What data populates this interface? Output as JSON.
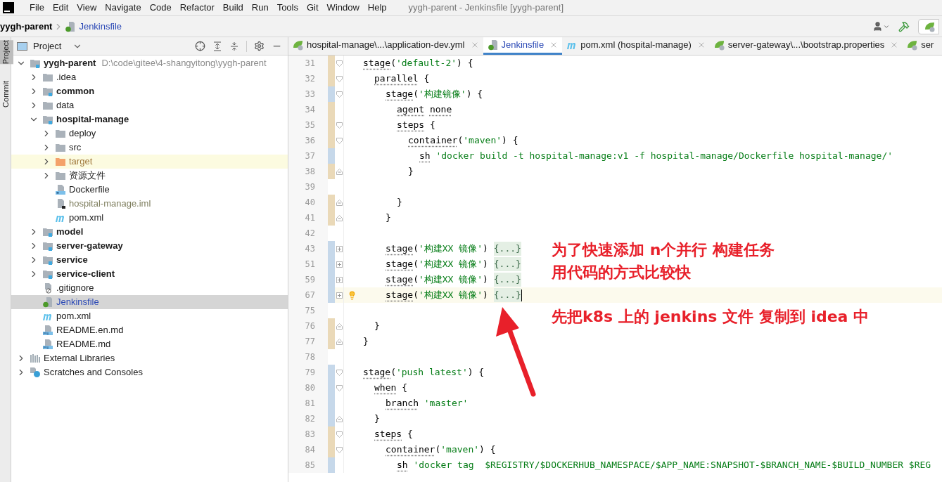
{
  "window": {
    "title": "yygh-parent - Jenkinsfile [yygh-parent]"
  },
  "menu": [
    "File",
    "Edit",
    "View",
    "Navigate",
    "Code",
    "Refactor",
    "Build",
    "Run",
    "Tools",
    "Git",
    "Window",
    "Help"
  ],
  "breadcrumb": [
    {
      "label": "yygh-parent",
      "kind": "project"
    },
    {
      "label": "Jenkinsfile",
      "kind": "file"
    }
  ],
  "side_tabs": [
    {
      "label": "Project",
      "selected": true
    },
    {
      "label": "Commit",
      "selected": false
    }
  ],
  "project_panel": {
    "title": "Project"
  },
  "tree": [
    {
      "label": "yygh-parent",
      "hint": "D:\\code\\gitee\\4-shangyitong\\yygh-parent",
      "kind": "module",
      "bold": true,
      "expanded": true,
      "selected": false,
      "children": [
        {
          "label": ".idea",
          "kind": "folder",
          "bold": false,
          "expanded": false,
          "selected": false
        },
        {
          "label": "common",
          "kind": "module",
          "bold": true,
          "expanded": false,
          "selected": false
        },
        {
          "label": "data",
          "kind": "folder",
          "bold": false,
          "expanded": false,
          "selected": false
        },
        {
          "label": "hospital-manage",
          "kind": "module",
          "bold": true,
          "expanded": true,
          "selected": false,
          "children": [
            {
              "label": "deploy",
              "kind": "folder",
              "bold": false,
              "expanded": false,
              "selected": false
            },
            {
              "label": "src",
              "kind": "folder",
              "bold": false,
              "expanded": false,
              "selected": false
            },
            {
              "label": "target",
              "kind": "excluded",
              "bold": false,
              "expanded": false,
              "selected": false
            },
            {
              "label": "资源文件",
              "kind": "folder",
              "bold": false,
              "expanded": false,
              "selected": false
            },
            {
              "label": "Dockerfile",
              "kind": "docker",
              "bold": false,
              "selected": false
            },
            {
              "label": "hospital-manage.iml",
              "kind": "iml",
              "bold": false,
              "selected": false
            },
            {
              "label": "pom.xml",
              "kind": "maven",
              "bold": false,
              "selected": false
            }
          ]
        },
        {
          "label": "model",
          "kind": "module",
          "bold": true,
          "expanded": false,
          "selected": false
        },
        {
          "label": "server-gateway",
          "kind": "module",
          "bold": true,
          "expanded": false,
          "selected": false
        },
        {
          "label": "service",
          "kind": "module",
          "bold": true,
          "expanded": false,
          "selected": false
        },
        {
          "label": "service-client",
          "kind": "module",
          "bold": true,
          "expanded": false,
          "selected": false
        },
        {
          "label": ".gitignore",
          "kind": "ignore",
          "bold": false,
          "selected": false
        },
        {
          "label": "Jenkinsfile",
          "kind": "groovy",
          "bold": false,
          "selected": true
        },
        {
          "label": "pom.xml",
          "kind": "maven",
          "bold": false,
          "selected": false
        },
        {
          "label": "README.en.md",
          "kind": "markdown",
          "bold": false,
          "selected": false
        },
        {
          "label": "README.md",
          "kind": "markdown",
          "bold": false,
          "selected": false
        }
      ]
    },
    {
      "label": "External Libraries",
      "kind": "libraries",
      "bold": false,
      "expanded": false,
      "selected": false
    },
    {
      "label": "Scratches and Consoles",
      "kind": "scratches",
      "bold": false,
      "expanded": false,
      "selected": false
    }
  ],
  "editor_tabs": [
    {
      "label": "hospital-manage\\...\\application-dev.yml",
      "kind": "leaf",
      "selected": false,
      "closable": true
    },
    {
      "label": "Jenkinsfile",
      "kind": "groovy",
      "selected": true,
      "closable": true
    },
    {
      "label": "pom.xml (hospital-manage)",
      "kind": "maven",
      "selected": false,
      "closable": true
    },
    {
      "label": "server-gateway\\...\\bootstrap.properties",
      "kind": "leaf",
      "selected": false,
      "closable": true
    },
    {
      "label": "ser",
      "kind": "leaf",
      "selected": false,
      "closable": false
    }
  ],
  "code": [
    {
      "number": "31",
      "marker": {
        "kind": "modified"
      },
      "fold": {
        "kind": "start"
      },
      "current": false,
      "parts": [
        {
          "kind": "kw",
          "text": "stage"
        },
        {
          "kind": "p",
          "text": "("
        },
        {
          "kind": "s",
          "text": "'default-2'"
        },
        {
          "kind": "p",
          "text": ") {"
        }
      ],
      "children": [
        {
          "number": "32",
          "marker": {
            "kind": "modified"
          },
          "fold": {
            "kind": "start"
          },
          "current": false,
          "parts": [
            {
              "kind": "kw",
              "text": "parallel"
            },
            {
              "kind": "p",
              "text": " {"
            }
          ],
          "children": [
            {
              "number": "33",
              "marker": {
                "kind": "added"
              },
              "fold": {
                "kind": "start"
              },
              "current": false,
              "parts": [
                {
                  "kind": "kw",
                  "text": "stage"
                },
                {
                  "kind": "p",
                  "text": "("
                },
                {
                  "kind": "s",
                  "text": "'构建镜像'"
                },
                {
                  "kind": "p",
                  "text": ") {"
                }
              ],
              "children": [
                {
                  "number": "34",
                  "marker": {
                    "kind": "modified"
                  },
                  "current": false,
                  "parts": [
                    {
                      "kind": "kw",
                      "text": "agent"
                    },
                    {
                      "kind": "kw",
                      "text": "none",
                      "spaced": true
                    }
                  ]
                },
                {
                  "number": "35",
                  "marker": {
                    "kind": "modified"
                  },
                  "fold": {
                    "kind": "start"
                  },
                  "current": false,
                  "parts": [
                    {
                      "kind": "kw",
                      "text": "steps"
                    },
                    {
                      "kind": "p",
                      "text": " {"
                    }
                  ],
                  "children": [
                    {
                      "number": "36",
                      "marker": {
                        "kind": "modified"
                      },
                      "fold": {
                        "kind": "start"
                      },
                      "current": false,
                      "parts": [
                        {
                          "kind": "kw",
                          "text": "container"
                        },
                        {
                          "kind": "p",
                          "text": "("
                        },
                        {
                          "kind": "s",
                          "text": "'maven'"
                        },
                        {
                          "kind": "p",
                          "text": ") {"
                        }
                      ],
                      "children": [
                        {
                          "number": "37",
                          "marker": {
                            "kind": "added"
                          },
                          "current": false,
                          "parts": [
                            {
                              "kind": "kw",
                              "text": "sh"
                            },
                            {
                              "kind": "s",
                              "text": "'docker build -t hospital-manage:v1 -f hospital-manage/Dockerfile hospital-manage/'",
                              "spaced": true
                            }
                          ]
                        }
                      ]
                    },
                    {
                      "number": "38",
                      "marker": {
                        "kind": "modified"
                      },
                      "fold": {
                        "kind": "end"
                      },
                      "current": false,
                      "parts": [
                        {
                          "kind": "p",
                          "text": "}"
                        }
                      ]
                    },
                    {
                      "number": "39",
                      "current": false
                    }
                  ]
                },
                {
                  "number": "40",
                  "marker": {
                    "kind": "modified"
                  },
                  "fold": {
                    "kind": "end"
                  },
                  "current": false,
                  "parts": [
                    {
                      "kind": "p",
                      "text": "}"
                    }
                  ]
                }
              ]
            },
            {
              "number": "41",
              "marker": {
                "kind": "modified"
              },
              "fold": {
                "kind": "end"
              },
              "current": false,
              "parts": [
                {
                  "kind": "p",
                  "text": "}"
                }
              ]
            },
            {
              "number": "42",
              "current": false
            },
            {
              "number": "43",
              "marker": {
                "kind": "added"
              },
              "fold": {
                "kind": "collapsed"
              },
              "current": false,
              "parts": [
                {
                  "kind": "kw",
                  "text": "stage"
                },
                {
                  "kind": "p",
                  "text": "("
                },
                {
                  "kind": "s",
                  "text": "'构建XX 镜像'"
                },
                {
                  "kind": "p",
                  "text": ")"
                },
                {
                  "kind": "f",
                  "text": "{...}",
                  "spaced": true
                }
              ]
            },
            {
              "number": "51",
              "marker": {
                "kind": "added"
              },
              "fold": {
                "kind": "collapsed"
              },
              "current": false,
              "parts": [
                {
                  "kind": "kw",
                  "text": "stage"
                },
                {
                  "kind": "p",
                  "text": "("
                },
                {
                  "kind": "s",
                  "text": "'构建XX 镜像'"
                },
                {
                  "kind": "p",
                  "text": ")"
                },
                {
                  "kind": "f",
                  "text": "{...}",
                  "spaced": true
                }
              ]
            },
            {
              "number": "59",
              "marker": {
                "kind": "added"
              },
              "fold": {
                "kind": "collapsed"
              },
              "current": false,
              "parts": [
                {
                  "kind": "kw",
                  "text": "stage"
                },
                {
                  "kind": "p",
                  "text": "("
                },
                {
                  "kind": "s",
                  "text": "'构建XX 镜像'"
                },
                {
                  "kind": "p",
                  "text": ")"
                },
                {
                  "kind": "f",
                  "text": "{...}",
                  "spaced": true
                }
              ]
            },
            {
              "number": "67",
              "marker": {
                "kind": "added"
              },
              "fold": {
                "kind": "collapsed"
              },
              "current": true,
              "parts": [
                {
                  "kind": "kw",
                  "text": "stage"
                },
                {
                  "kind": "p",
                  "text": "("
                },
                {
                  "kind": "s",
                  "text": "'构建XX 镜像'"
                },
                {
                  "kind": "p",
                  "text": ")"
                },
                {
                  "kind": "f",
                  "text": "{...}",
                  "spaced": true
                }
              ]
            },
            {
              "number": "75",
              "current": false
            }
          ]
        },
        {
          "number": "76",
          "marker": {
            "kind": "modified"
          },
          "fold": {
            "kind": "end"
          },
          "current": false,
          "parts": [
            {
              "kind": "p",
              "text": "}"
            }
          ]
        }
      ]
    },
    {
      "number": "77",
      "marker": {
        "kind": "modified"
      },
      "fold": {
        "kind": "end"
      },
      "current": false,
      "parts": [
        {
          "kind": "p",
          "text": "}"
        }
      ]
    },
    {
      "number": "78",
      "current": false
    },
    {
      "number": "79",
      "marker": {
        "kind": "added"
      },
      "fold": {
        "kind": "start"
      },
      "current": false,
      "parts": [
        {
          "kind": "kw",
          "text": "stage"
        },
        {
          "kind": "p",
          "text": "("
        },
        {
          "kind": "s",
          "text": "'push latest'"
        },
        {
          "kind": "p",
          "text": ") {"
        }
      ],
      "children": [
        {
          "number": "80",
          "marker": {
            "kind": "added"
          },
          "fold": {
            "kind": "start"
          },
          "current": false,
          "parts": [
            {
              "kind": "kw",
              "text": "when"
            },
            {
              "kind": "p",
              "text": " {"
            }
          ],
          "children": [
            {
              "number": "81",
              "marker": {
                "kind": "added"
              },
              "current": false,
              "parts": [
                {
                  "kind": "kw",
                  "text": "branch"
                },
                {
                  "kind": "s",
                  "text": "'master'",
                  "spaced": true
                }
              ]
            }
          ]
        },
        {
          "number": "82",
          "marker": {
            "kind": "added"
          },
          "fold": {
            "kind": "end"
          },
          "current": false,
          "parts": [
            {
              "kind": "p",
              "text": "}"
            }
          ]
        },
        {
          "number": "83",
          "marker": {
            "kind": "modified"
          },
          "fold": {
            "kind": "start"
          },
          "current": false,
          "parts": [
            {
              "kind": "kw",
              "text": "steps"
            },
            {
              "kind": "p",
              "text": " {"
            }
          ],
          "children": [
            {
              "number": "84",
              "marker": {
                "kind": "modified"
              },
              "fold": {
                "kind": "start"
              },
              "current": false,
              "parts": [
                {
                  "kind": "kw",
                  "text": "container"
                },
                {
                  "kind": "p",
                  "text": "("
                },
                {
                  "kind": "s",
                  "text": "'maven'"
                },
                {
                  "kind": "p",
                  "text": ") {"
                }
              ],
              "children": [
                {
                  "number": "85",
                  "marker": {
                    "kind": "added"
                  },
                  "current": false,
                  "parts": [
                    {
                      "kind": "kw",
                      "text": "sh"
                    },
                    {
                      "kind": "s",
                      "text": "'docker tag  $REGISTRY/$DOCKERHUB_NAMESPACE/$APP_NAME:SNAPSHOT-$BRANCH_NAME-$BUILD_NUMBER $REG",
                      "spaced": true
                    }
                  ]
                }
              ]
            }
          ]
        }
      ]
    }
  ],
  "annotations": [
    "为了快速添加 n个并行 构建任务",
    "用代码的方式比较快",
    "先把k8s 上的 jenkins 文件 复制到 idea 中"
  ]
}
